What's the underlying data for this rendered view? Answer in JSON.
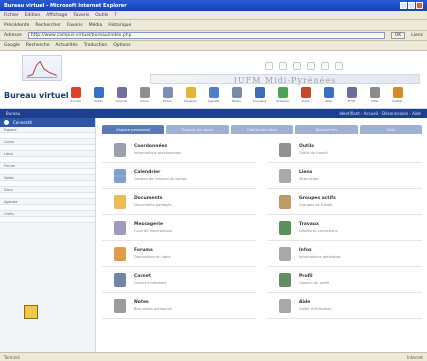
{
  "window": {
    "title": "Bureau virtuel - Microsoft Internet Explorer"
  },
  "menu": [
    "Fichier",
    "Edition",
    "Affichage",
    "Favoris",
    "Outils",
    "?"
  ],
  "toolbar": [
    "Précédente",
    "Rechercher",
    "Favoris",
    "Média",
    "Historique"
  ],
  "address": {
    "label": "Adresse",
    "value": "http://www.campus-virtuel/bureau/index.php",
    "go": "OK",
    "links": "Liens"
  },
  "links": [
    "Google",
    "Recherche",
    "Actualités",
    "Traduction",
    "Options"
  ],
  "site": {
    "banner_title": "IUFM Midi-Pyrénées",
    "app_title": "Bureau virtuel"
  },
  "appnav": [
    {
      "label": "Accueil",
      "icon": "home-icon",
      "color": "#d9432f"
    },
    {
      "label": "Outils",
      "icon": "tools-icon",
      "color": "#3c6fc4"
    },
    {
      "label": "Courrier",
      "icon": "mail-icon",
      "color": "#6f6f9c"
    },
    {
      "label": "Cours",
      "icon": "course-icon",
      "color": "#8f8f8f"
    },
    {
      "label": "Forum",
      "icon": "forum-icon",
      "color": "#7c8fb0"
    },
    {
      "label": "Dossiers",
      "icon": "folder-icon",
      "color": "#e8b13a"
    },
    {
      "label": "Agenda",
      "icon": "agenda-icon",
      "color": "#4f7dd0"
    },
    {
      "label": "Notes",
      "icon": "notes-icon",
      "color": "#7b8aa8"
    },
    {
      "label": "Annuaire",
      "icon": "directory-icon",
      "color": "#3d6db6"
    },
    {
      "label": "Groupes",
      "icon": "groups-icon",
      "color": "#49a35b"
    },
    {
      "label": "Liens",
      "icon": "links-icon",
      "color": "#c44a2b"
    },
    {
      "label": "Aide",
      "icon": "help-icon",
      "color": "#3c6fc4"
    },
    {
      "label": "Profil",
      "icon": "profile-icon",
      "color": "#6f6f9c"
    },
    {
      "label": "Infos",
      "icon": "info-icon",
      "color": "#8a8a8a"
    },
    {
      "label": "Quitter",
      "icon": "quit-icon",
      "color": "#d98b2b"
    }
  ],
  "strip": {
    "left": "Bureau",
    "right": "Identifiant - Accueil - Déconnexion - Aide"
  },
  "sidebar": {
    "head": "Connecté",
    "rows": [
      "Espace",
      "",
      "Cours",
      "",
      "Liens",
      "",
      "Forum",
      "",
      "Notes",
      "",
      "Docs",
      "",
      "Agenda",
      "",
      "Outils",
      ""
    ]
  },
  "tabs": [
    {
      "label": "Espace personnel",
      "active": true
    },
    {
      "label": "Espace de cours",
      "active": false
    },
    {
      "label": "Communication",
      "active": false
    },
    {
      "label": "Ressources",
      "active": false
    },
    {
      "label": "Aide",
      "active": false
    }
  ],
  "cells": [
    {
      "title": "Coordonnées",
      "desc": "Informations personnelles",
      "icon": "contact-card-icon",
      "color": "#8a8fa0"
    },
    {
      "title": "Outils",
      "desc": "Outils de travail",
      "icon": "tools-icon",
      "color": "#7d7d7d"
    },
    {
      "title": "Calendrier",
      "desc": "Gestion de l'emploi du temps",
      "icon": "calendar-icon",
      "color": "#6d8fc9"
    },
    {
      "title": "Liens",
      "desc": "Sites utiles",
      "icon": "links-icon",
      "color": "#9a9a9a"
    },
    {
      "title": "Documents",
      "desc": "Documents partagés",
      "icon": "folder-icon",
      "color": "#e8b13a"
    },
    {
      "title": "Groupes actifs",
      "desc": "Groupes de travail",
      "icon": "groups-icon",
      "color": "#b08a4a"
    },
    {
      "title": "Messagerie",
      "desc": "Courrier électronique",
      "icon": "mail-icon",
      "color": "#8a8aa8"
    },
    {
      "title": "Travaux",
      "desc": "Dépôts et corrections",
      "icon": "tree-icon",
      "color": "#3d7f3d"
    },
    {
      "title": "Forums",
      "desc": "Discussions en ligne",
      "icon": "forum-icon",
      "color": "#d98b2b"
    },
    {
      "title": "Infos",
      "desc": "Informations générales",
      "icon": "info-icon",
      "color": "#9a9a9a"
    },
    {
      "title": "Carnet",
      "desc": "Carnet d'adresses",
      "icon": "notebook-icon",
      "color": "#5a6d9c"
    },
    {
      "title": "Profil",
      "desc": "Gestion du profil",
      "icon": "profile-icon",
      "color": "#4a7a4a"
    },
    {
      "title": "Notes",
      "desc": "Bloc-notes personnel",
      "icon": "notes-icon",
      "color": "#8a8a8a"
    },
    {
      "title": "Aide",
      "desc": "Guide d'utilisation",
      "icon": "help-icon",
      "color": "#9a9a9a"
    }
  ],
  "status": {
    "left": "Terminé",
    "right": "Internet"
  }
}
